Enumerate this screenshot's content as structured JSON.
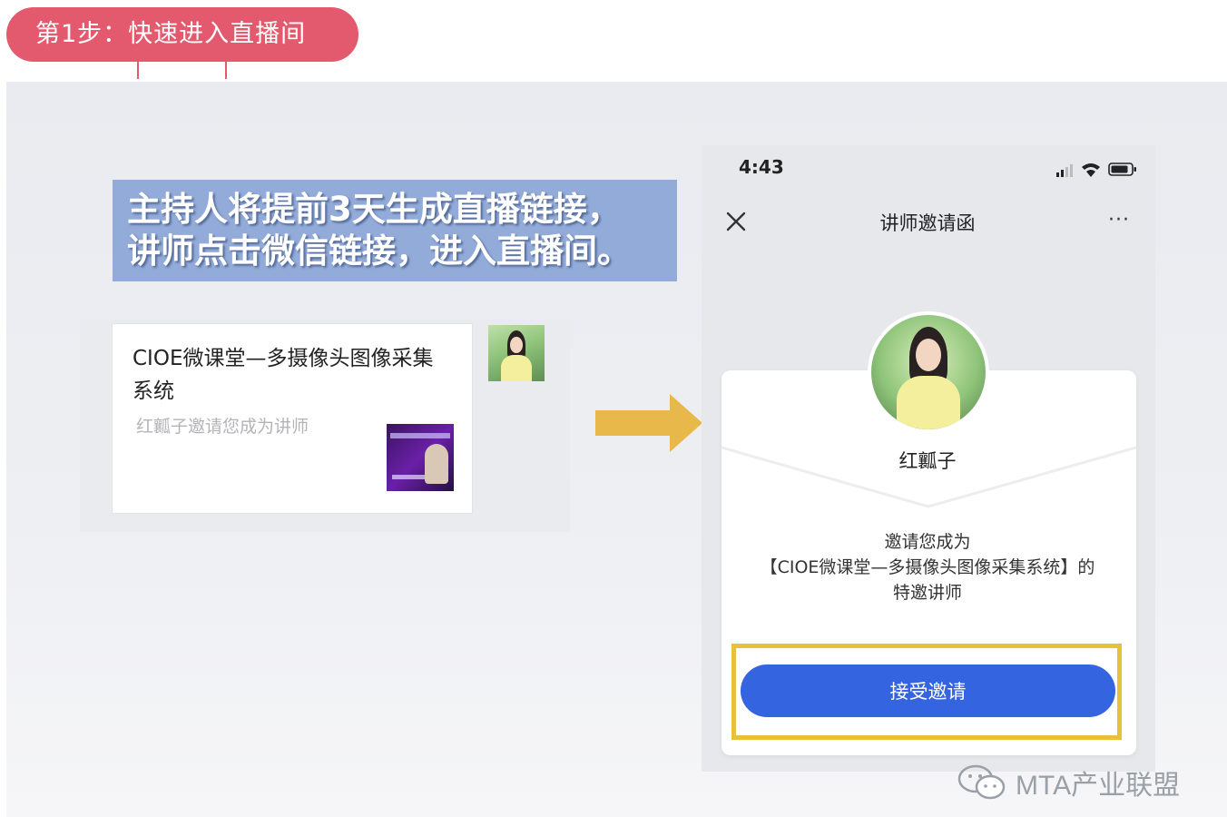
{
  "step_label": "第1步：快速进入直播间",
  "headline": {
    "line1": "主持人将提前3天生成直播链接，",
    "line2": "讲师点击微信链接，进入直播间。"
  },
  "chat_card": {
    "title": "CIOE微课堂—多摄像头图像采集系统",
    "subtitle": "红瓤子邀请您成为讲师"
  },
  "phone": {
    "status_time": "4:43",
    "nav_title": "讲师邀请函",
    "nav_more": "···",
    "inviter_name": "红瓤子",
    "invite_line1": "邀请您成为",
    "invite_line2": "【CIOE微课堂—多摄像头图像采集系统】的",
    "invite_line3": "特邀讲师",
    "accept_label": "接受邀请"
  },
  "watermark": "MTA产业联盟",
  "colors": {
    "step_pill": "#e35a6e",
    "headline_bg": "#92abd8",
    "arrow": "#e8b84a",
    "accept_button": "#3464e0",
    "highlight_border": "#e8c13a"
  },
  "icons": [
    "close-icon",
    "signal-icon",
    "wifi-icon",
    "battery-icon",
    "wechat-icon",
    "arrow-right-icon"
  ]
}
